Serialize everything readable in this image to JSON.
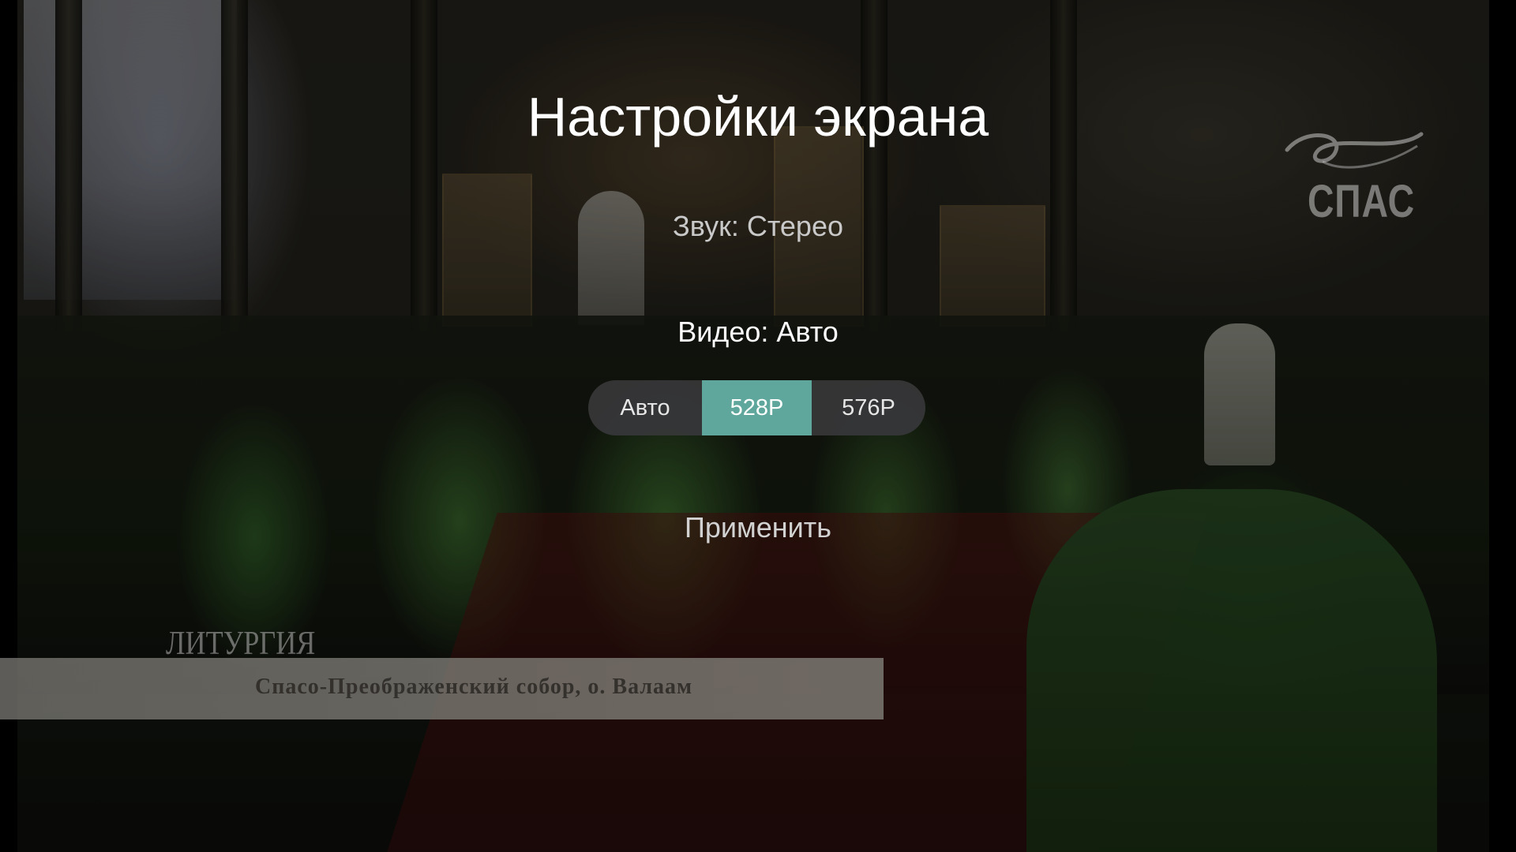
{
  "settings": {
    "title": "Настройки экрана",
    "sound_label": "Звук: Стерео",
    "video_label": "Видео: Авто",
    "video_options": [
      "Авто",
      "528P",
      "576P"
    ],
    "selected_video_option": "528P",
    "apply_label": "Применить",
    "accent_color": "#5fa79d"
  },
  "video": {
    "channel_logo": "СПАС",
    "program_title": "ЛИТУРГИЯ",
    "location_caption": "Спасо-Преображенский собор, о. Валаам"
  }
}
